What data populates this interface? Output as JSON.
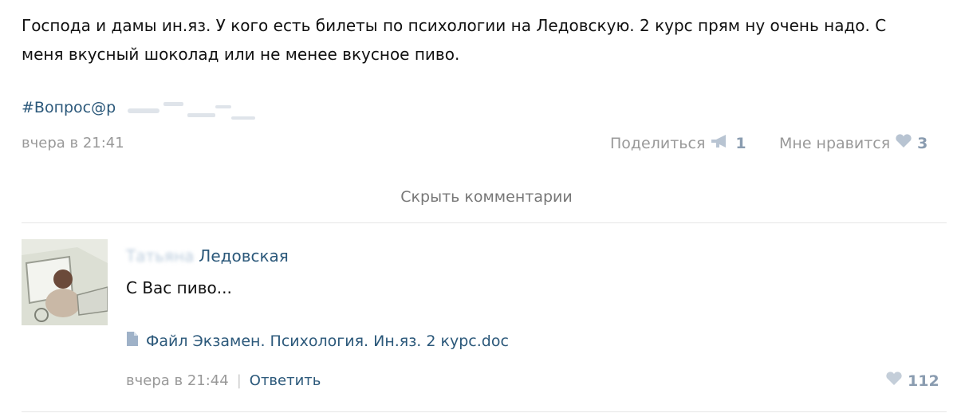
{
  "post": {
    "text_line1": "Господа и дамы ин.яз. У кого есть билеты по психологии на Ледовскую. 2 курс прям ну очень надо. С",
    "text_line2": "меня вкусный шоколад или не менее вкусное пиво.",
    "hashtag": "#Вопрос@",
    "hashtag_partial": "р",
    "date": "вчера в 21:41",
    "share_label": "Поделиться",
    "share_count": "1",
    "like_label": "Мне нравится",
    "like_count": "3",
    "share_icon": "megaphone-icon",
    "like_icon": "heart-icon"
  },
  "comments_toggle": {
    "label": "Скрыть комментарии"
  },
  "comment": {
    "author_first": "Татьяна",
    "author_last": "Ледовская",
    "text": "С Вас пиво...",
    "attachment_label": "Файл Экзамен. Психология. Ин.яз. 2 курс.doc",
    "attachment_icon": "document-icon",
    "date": "вчера в 21:44",
    "separator": "|",
    "reply_label": "Ответить",
    "like_count": "112"
  },
  "colors": {
    "link": "#2b587a",
    "muted": "#999999",
    "divider": "#e6e6e6",
    "like_count": "#8a9cb0"
  }
}
